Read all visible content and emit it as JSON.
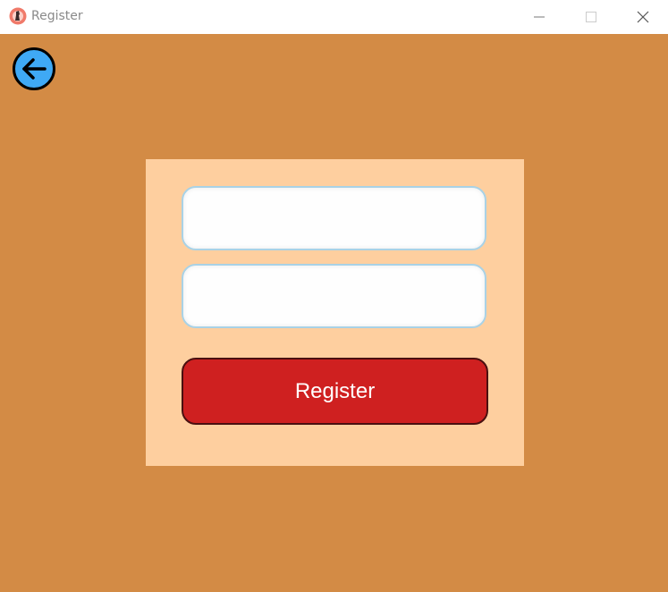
{
  "window": {
    "title": "Register",
    "icons": {
      "app": "chess-app-icon",
      "minimize": "minimize-icon",
      "maximize": "maximize-icon",
      "close": "close-icon"
    }
  },
  "nav": {
    "back_icon": "arrow-left-icon"
  },
  "form": {
    "username": {
      "value": "",
      "placeholder": ""
    },
    "password": {
      "value": "",
      "placeholder": ""
    },
    "submit_label": "Register"
  },
  "colors": {
    "background": "#d38b45",
    "panel": "#fecf9f",
    "field_border": "#a9d2e6",
    "button": "#cf2020",
    "back_button": "#3fa9f5"
  }
}
